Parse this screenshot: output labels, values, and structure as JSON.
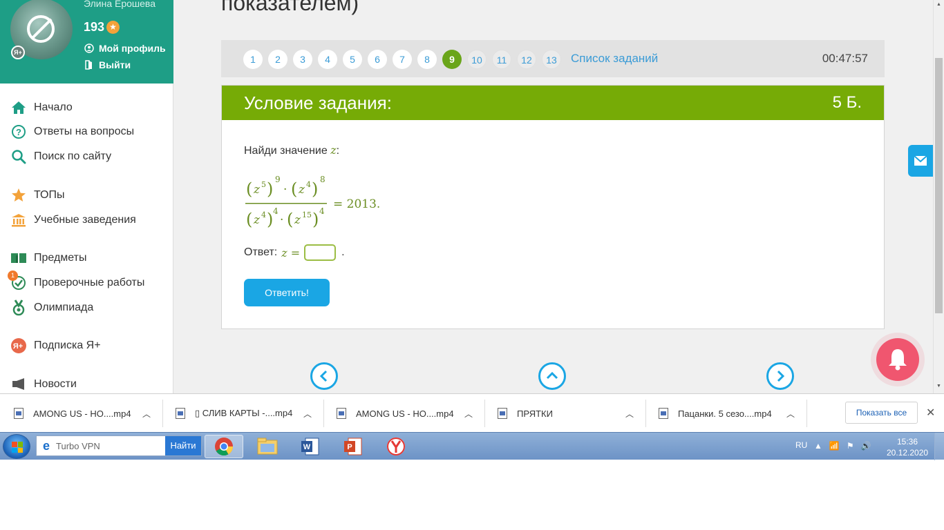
{
  "profile": {
    "name": "Элина Ерошева",
    "points": "193",
    "my_profile": "Мой профиль",
    "logout": "Выйти",
    "badge": "Я+"
  },
  "sidebar": {
    "items": [
      {
        "label": "Начало",
        "icon": "home-icon"
      },
      {
        "label": "Ответы на вопросы",
        "icon": "question-circle-icon"
      },
      {
        "label": "Поиск по сайту",
        "icon": "search-icon"
      },
      {
        "label": "ТОПы",
        "icon": "star-icon"
      },
      {
        "label": "Учебные заведения",
        "icon": "institution-icon"
      },
      {
        "label": "Предметы",
        "icon": "books-icon"
      },
      {
        "label": "Проверочные работы",
        "icon": "check-circle-icon",
        "badge": "1"
      },
      {
        "label": "Олимпиада",
        "icon": "medal-icon"
      },
      {
        "label": "Подписка Я+",
        "icon": "yaplus-icon"
      },
      {
        "label": "Новости",
        "icon": "megaphone-icon"
      }
    ]
  },
  "page": {
    "heading": "показателем)"
  },
  "task_nav": {
    "numbers": [
      "1",
      "2",
      "3",
      "4",
      "5",
      "6",
      "7",
      "8",
      "9",
      "10",
      "11",
      "12",
      "13"
    ],
    "active_index": 8,
    "list_link": "Список заданий",
    "timer": "00:47:57"
  },
  "task": {
    "title": "Условие задания:",
    "points": "5 Б.",
    "question_prefix": "Найди значение",
    "variable": "z",
    "colon": ":",
    "formula": {
      "num_a_base": "z",
      "num_a_inner_exp": "5",
      "num_a_outer_exp": "9",
      "num_b_base": "z",
      "num_b_inner_exp": "4",
      "num_b_outer_exp": "8",
      "den_a_base": "z",
      "den_a_inner_exp": "4",
      "den_a_outer_exp": "4",
      "den_b_base": "z",
      "den_b_inner_exp": "15",
      "den_b_outer_exp": "4",
      "rhs": "= 2013."
    },
    "answer_label": "Ответ:",
    "answer_var": "z =",
    "answer_value": "",
    "answer_suffix": ".",
    "submit": "Ответить!"
  },
  "downloads": {
    "items": [
      {
        "name": "AMONG US - HO....mp4"
      },
      {
        "name": "▯ СЛИВ КАРТЫ -....mp4"
      },
      {
        "name": "AMONG US - HO....mp4"
      },
      {
        "name": "ПРЯТКИ"
      },
      {
        "name": "Пацанки. 5 сезо....mp4"
      }
    ],
    "show_all": "Показать все"
  },
  "taskbar": {
    "search_text": "Turbo VPN",
    "search_button": "Найти",
    "lang": "RU",
    "time": "15:36",
    "date": "20.12.2020"
  },
  "colors": {
    "brand_teal": "#1e9e86",
    "accent_green": "#76ab06",
    "link_blue": "#3a9bd6",
    "button_blue": "#1aa6e4",
    "bell_pink": "#f0566f"
  }
}
